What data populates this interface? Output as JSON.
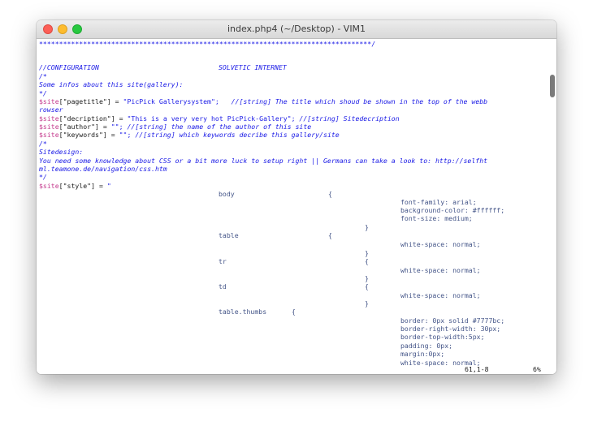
{
  "window": {
    "title": "index.php4 (~/Desktop) - VIM1"
  },
  "lines": {
    "l1": "***********************************************************************************/",
    "l2a": "//CONFIGURATION",
    "l2b": "SOLVETIC INTERNET",
    "l3": "/*",
    "l4": "Some infos about this site(gallery):",
    "l5": "*/",
    "l6_var": "$site",
    "l6_key": "[\"pagetitle\"] = ",
    "l6_val": "\"PicPick Gallerysystem\";",
    "l6_cmt": "   //[string] The title which shoud be shown in the top of the webb",
    "l7": "rowser",
    "l8_var": "$site",
    "l8_key": "[\"decription\"] = ",
    "l8_val": "\"This is a very very hot PicPick-Gallery\";",
    "l8_cmt": " //[string] Sitedecription",
    "l9_var": "$site",
    "l9_key": "[\"author\"] = ",
    "l9_val": "\"\";",
    "l9_cmt": " //[string] the name of the author of this site",
    "l10_var": "$site",
    "l10_key": "[\"keywords\"] = ",
    "l10_val": "\"\";",
    "l10_cmt": " //[string] which keywords decribe this gallery/site",
    "l11": "/*",
    "l12": "Sitedesign:",
    "l13": "You need some knowledge about CSS or a bit more luck to setup right || Germans can take a look to: http://selfht",
    "l14": "ml.teamone.de/navigation/css.htm",
    "l15": "*/",
    "l16_var": "$site",
    "l16_key": "[\"style\"] = ",
    "l16_val": "\"",
    "body_sel": "body",
    "brace_open": "{",
    "brace_close": "}",
    "body_p1": "font-family: arial;",
    "body_p2": "background-color: #ffffff;",
    "body_p3": "font-size: medium;",
    "table_sel": "table",
    "ws": "white-space: normal;",
    "tr_sel": "tr",
    "td_sel": "td",
    "thumbs_sel": "table.thumbs",
    "th_p1": "border: 0px solid #7777bc;",
    "th_p2": "border-right-width: 30px;",
    "th_p3": "border-top-width:5px;",
    "th_p4": "padding: 0px;",
    "th_p5": "margin:0px;",
    "th_p6": "white-space: normal;"
  },
  "status": {
    "position": "61,1-8",
    "percent": "6%"
  }
}
